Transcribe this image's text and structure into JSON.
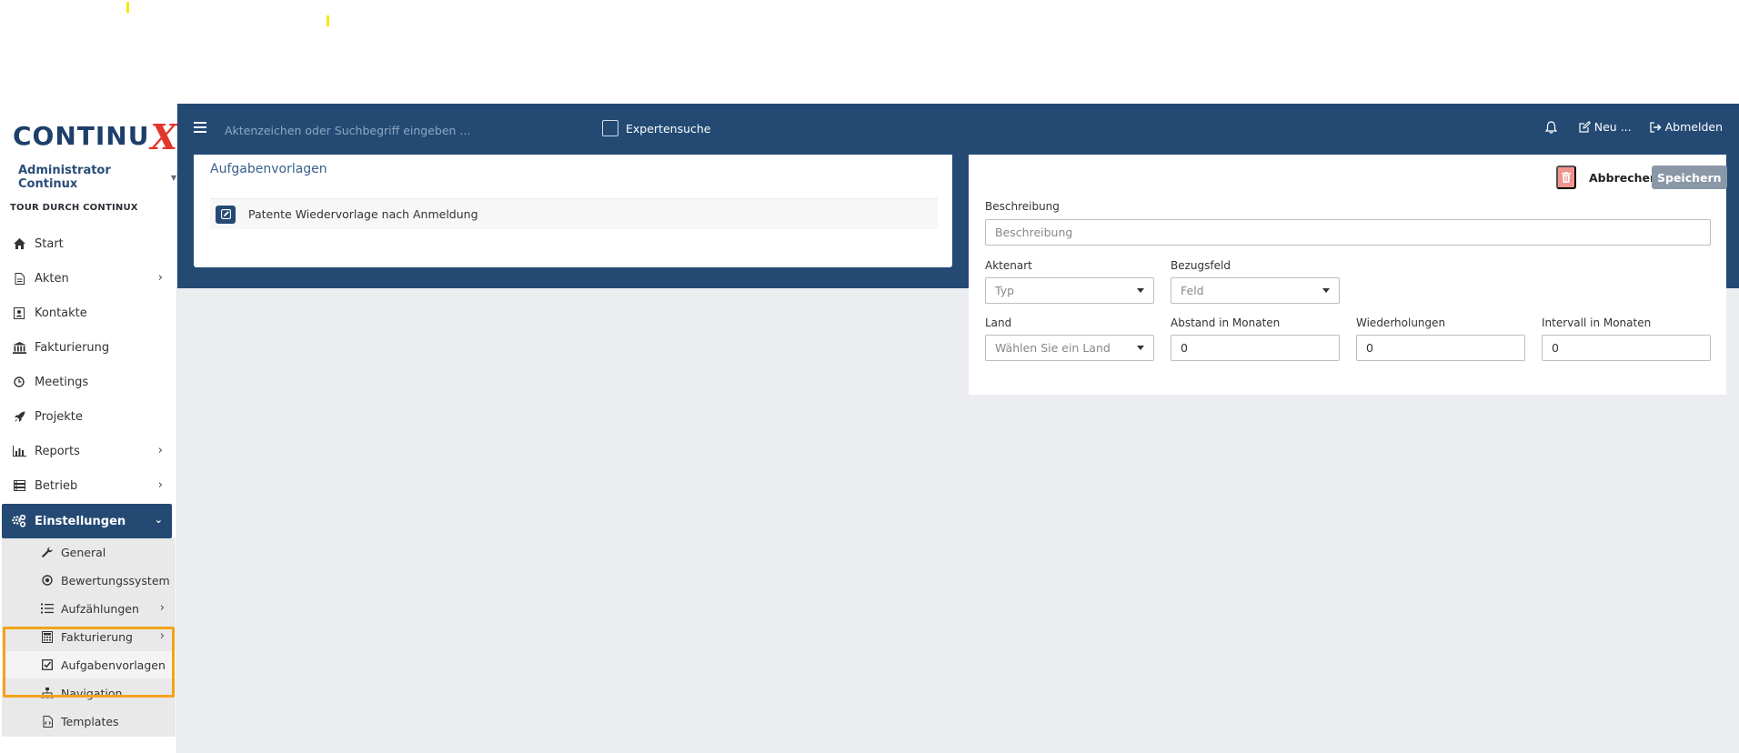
{
  "logo": {
    "text": "CONTINU",
    "x": "X"
  },
  "user": {
    "name": "Administrator Continux"
  },
  "tour_label": "TOUR DURCH CONTINUX",
  "nav": {
    "start": "Start",
    "akten": "Akten",
    "kontakte": "Kontakte",
    "fakturierung": "Fakturierung",
    "meetings": "Meetings",
    "projekte": "Projekte",
    "reports": "Reports",
    "betrieb": "Betrieb",
    "einstellungen": "Einstellungen"
  },
  "submenu": {
    "general": "General",
    "bewertungssystem": "Bewertungssystem",
    "aufzaehlungen": "Aufzählungen",
    "fakturierung": "Fakturierung",
    "aufgabenvorlagen": "Aufgabenvorlagen",
    "navigation": "Navigation",
    "templates": "Templates"
  },
  "topbar": {
    "search_placeholder": "Aktenzeichen oder Suchbegriff eingeben ...",
    "expert_label": "Expertensuche",
    "new_label": "Neu ...",
    "logout_label": "Abmelden"
  },
  "left_panel": {
    "title": "Aufgabenvorlagen",
    "rows": [
      {
        "label": "Patente Wiedervorlage nach Anmeldung"
      }
    ]
  },
  "form": {
    "cancel_label": "Abbrechen",
    "save_label": "Speichern",
    "beschreibung": {
      "label": "Beschreibung",
      "placeholder": "Beschreibung"
    },
    "aktenart": {
      "label": "Aktenart",
      "value": "Typ"
    },
    "bezugsfeld": {
      "label": "Bezugsfeld",
      "value": "Feld"
    },
    "land": {
      "label": "Land",
      "value": "Wählen Sie ein Land"
    },
    "abstand": {
      "label": "Abstand in Monaten",
      "value": "0"
    },
    "wiederholungen": {
      "label": "Wiederholungen",
      "value": "0"
    },
    "intervall": {
      "label": "Intervall in Monaten",
      "value": "0"
    }
  },
  "colors": {
    "primary": "#244a74",
    "logo_red": "#e2352b",
    "highlight": "#f5a31a",
    "delete": "#f0938d",
    "save": "#8a97a6"
  }
}
